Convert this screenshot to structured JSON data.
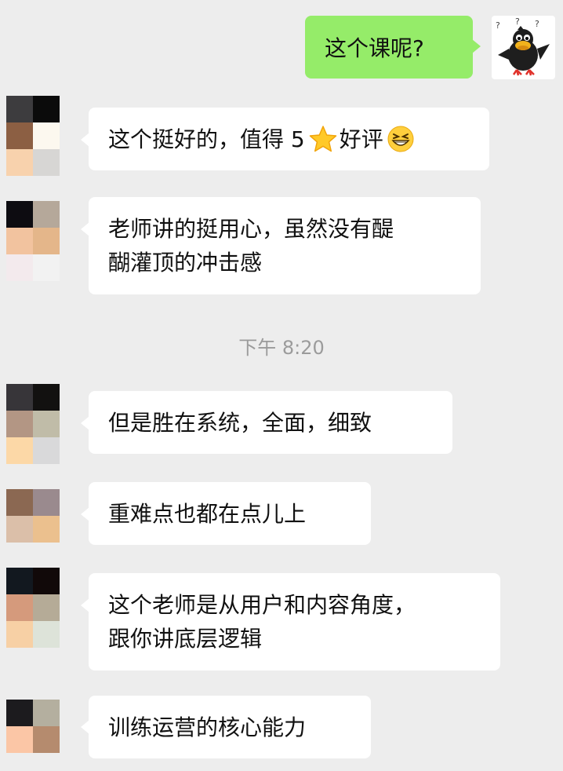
{
  "messages": [
    {
      "side": "out",
      "text": "这个课呢?"
    },
    {
      "side": "in",
      "text_before": "这个挺好的，值得 5",
      "star_icon": "star-icon",
      "text_after": "好评",
      "emoji_icon": "grin-emoji-icon"
    },
    {
      "side": "in",
      "lines": [
        "老师讲的挺用心，虽然没有醍",
        "醐灌顶的冲击感"
      ]
    },
    {
      "side": "in",
      "text": "但是胜在系统，全面，细致"
    },
    {
      "side": "in",
      "text": "重难点也都在点儿上"
    },
    {
      "side": "in",
      "lines": [
        "这个老师是从用户和内容角度，",
        "跟你讲底层逻辑"
      ]
    },
    {
      "side": "in",
      "text": "训练运营的核心能力"
    }
  ],
  "timestamp": "下午 8:20",
  "colors": {
    "background": "#ededed",
    "outgoing_bubble": "#95ec69",
    "incoming_bubble": "#ffffff",
    "timestamp_text": "#9b9b9b"
  },
  "avatars": {
    "self": "cartoon-crow-avatar",
    "contact": "pixelated-avatar"
  }
}
